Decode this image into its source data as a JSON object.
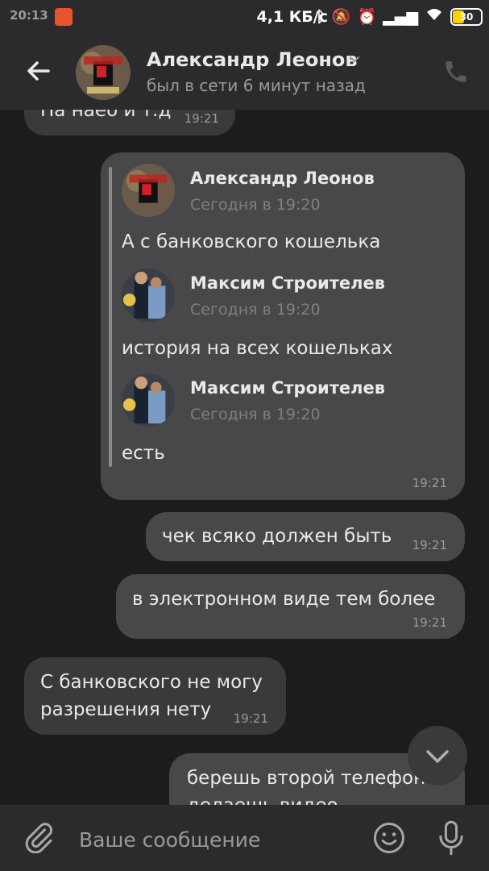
{
  "status_bar": {
    "time": "20:13",
    "network_speed": "4,1 КБ/с",
    "battery": "30"
  },
  "header": {
    "name": "Александр Леонов",
    "status": "был в сети 6 минут назад"
  },
  "messages": [
    {
      "id": "m0",
      "direction": "incoming",
      "text": "На наеб и т.д",
      "time": "19:21"
    },
    {
      "id": "m1",
      "direction": "outgoing",
      "time": "19:21",
      "forwarded": [
        {
          "author": "Александр Леонов",
          "date": "Сегодня в 19:20",
          "text": "А с банковского кошелька"
        },
        {
          "author": "Максим Строителев",
          "date": "Сегодня в 19:20",
          "text": "история на всех кошельках"
        },
        {
          "author": "Максим Строителев",
          "date": "Сегодня в 19:20",
          "text": "есть"
        }
      ]
    },
    {
      "id": "m2",
      "direction": "outgoing",
      "text": "чек всяко должен быть",
      "time": "19:21"
    },
    {
      "id": "m3",
      "direction": "outgoing",
      "text": "в электронном виде тем более",
      "time": "19:21"
    },
    {
      "id": "m4",
      "direction": "incoming",
      "text": "С банковского не могу\nразрешения нету",
      "time": "19:21"
    },
    {
      "id": "m5",
      "direction": "outgoing",
      "text": "берешь второй телефон и\nделаешь видео",
      "time": ""
    }
  ],
  "composer": {
    "placeholder": "Ваше сообщение"
  },
  "icons": {
    "back": "arrow-left-icon",
    "call": "phone-icon",
    "attach": "paperclip-icon",
    "emoji": "smile-icon",
    "mic": "microphone-icon",
    "scroll": "chevron-down-icon"
  },
  "colors": {
    "background": "#1c1c1d",
    "incoming_bubble": "#3a3a3c",
    "outgoing_bubble": "#48484a",
    "header": "#2b2b2d"
  }
}
